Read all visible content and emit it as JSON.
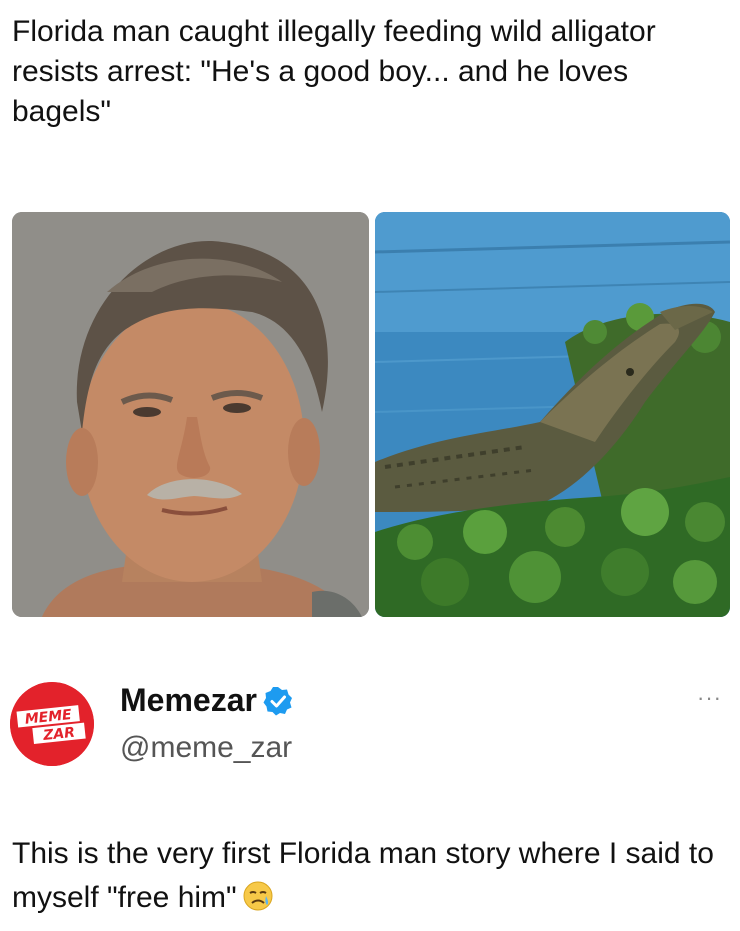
{
  "headline": "Florida man caught illegally feeding wild alligator resists arrest: \"He's a good boy... and he loves bagels\"",
  "images": {
    "left": {
      "icon": "man-portrait-photo"
    },
    "right": {
      "icon": "alligator-photo"
    }
  },
  "post": {
    "avatar": {
      "line1": "MEME",
      "line2": "ZAR",
      "color": "#e3222b"
    },
    "display_name": "Memezar",
    "verified_icon": "verified-badge-icon",
    "verified_color": "#1d9bf0",
    "handle": "@meme_zar",
    "more_icon": "more-options-icon",
    "text": "This is the very first Florida man story where I said to myself \"free him\"",
    "emoji": "sad-face-emoji"
  }
}
